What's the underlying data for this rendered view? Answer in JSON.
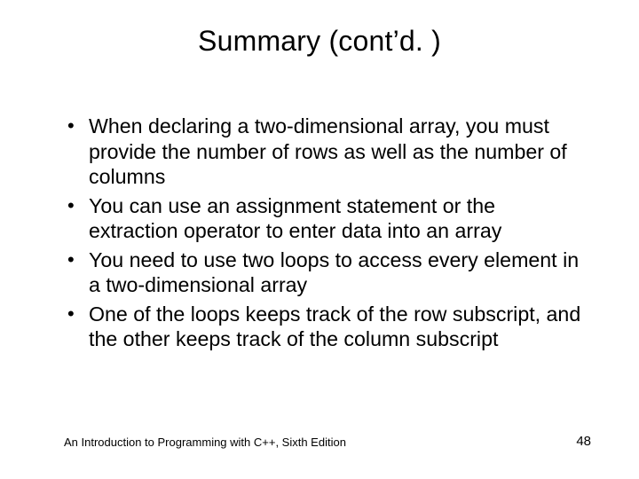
{
  "title": "Summary (cont’d. )",
  "bullets": [
    "When declaring a two-dimensional array, you must provide the number of rows as well as the number of columns",
    "You can use an assignment statement or the extraction operator to enter data into an array",
    "You need to use two loops to access every element in a two-dimensional array",
    "One of the loops keeps track of the row subscript, and the other keeps track of the column subscript"
  ],
  "footer": {
    "book": "An Introduction to Programming with C++, Sixth Edition",
    "page": "48"
  }
}
